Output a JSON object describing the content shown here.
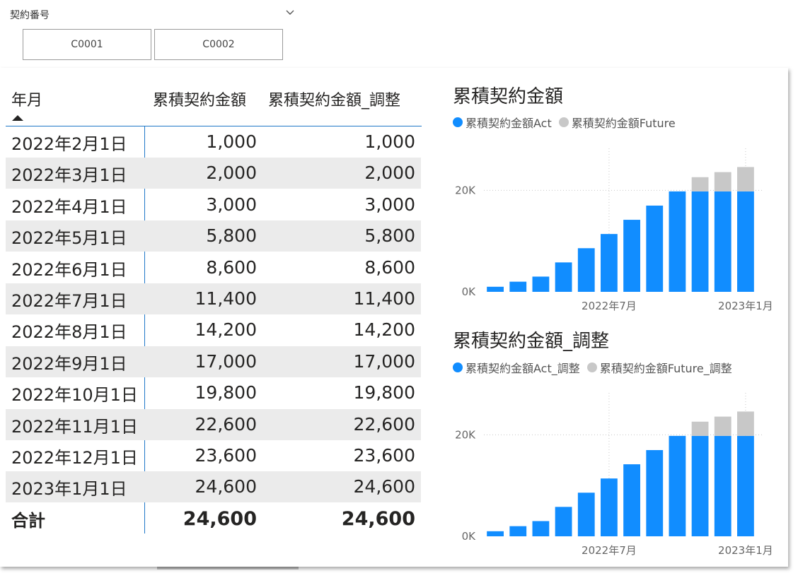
{
  "slicer": {
    "title": "契約番号",
    "options": [
      "C0001",
      "C0002"
    ]
  },
  "table": {
    "headers": [
      "年月",
      "累積契約金額",
      "累積契約金額_調整"
    ],
    "rows": [
      [
        "2022年2月1日",
        "1,000",
        "1,000"
      ],
      [
        "2022年3月1日",
        "2,000",
        "2,000"
      ],
      [
        "2022年4月1日",
        "3,000",
        "3,000"
      ],
      [
        "2022年5月1日",
        "5,800",
        "5,800"
      ],
      [
        "2022年6月1日",
        "8,600",
        "8,600"
      ],
      [
        "2022年7月1日",
        "11,400",
        "11,400"
      ],
      [
        "2022年8月1日",
        "14,200",
        "14,200"
      ],
      [
        "2022年9月1日",
        "17,000",
        "17,000"
      ],
      [
        "2022年10月1日",
        "19,800",
        "19,800"
      ],
      [
        "2022年11月1日",
        "22,600",
        "22,600"
      ],
      [
        "2022年12月1日",
        "23,600",
        "23,600"
      ],
      [
        "2023年1月1日",
        "24,600",
        "24,600"
      ]
    ],
    "total": [
      "合計",
      "24,600",
      "24,600"
    ]
  },
  "colors": {
    "act": "#118DFF",
    "future": "#C8C8C8",
    "table_line": "#1F78C8",
    "row_alt": "#EBEBEB"
  },
  "chart_data": [
    {
      "type": "bar",
      "stacked": true,
      "title": "累積契約金額",
      "categories": [
        "2022-02",
        "2022-03",
        "2022-04",
        "2022-05",
        "2022-06",
        "2022-07",
        "2022-08",
        "2022-09",
        "2022-10",
        "2022-11",
        "2022-12",
        "2023-01"
      ],
      "x_tick_labels": [
        "2022年7月",
        "2023年1月"
      ],
      "y_tick_labels": [
        "0K",
        "20K"
      ],
      "ylim": [
        0,
        28000
      ],
      "grid": true,
      "legend_position": "top-left",
      "series": [
        {
          "name": "累積契約金額Act",
          "color": "#118DFF",
          "values": [
            1000,
            2000,
            3000,
            5800,
            8600,
            11400,
            14200,
            17000,
            19800,
            19800,
            19800,
            19800
          ]
        },
        {
          "name": "累積契約金額Future",
          "color": "#C8C8C8",
          "values": [
            0,
            0,
            0,
            0,
            0,
            0,
            0,
            0,
            0,
            2800,
            3800,
            4800
          ]
        }
      ]
    },
    {
      "type": "bar",
      "stacked": true,
      "title": "累積契約金額_調整",
      "categories": [
        "2022-02",
        "2022-03",
        "2022-04",
        "2022-05",
        "2022-06",
        "2022-07",
        "2022-08",
        "2022-09",
        "2022-10",
        "2022-11",
        "2022-12",
        "2023-01"
      ],
      "x_tick_labels": [
        "2022年7月",
        "2023年1月"
      ],
      "y_tick_labels": [
        "0K",
        "20K"
      ],
      "ylim": [
        0,
        28000
      ],
      "grid": true,
      "legend_position": "top-left",
      "series": [
        {
          "name": "累積契約金額Act_調整",
          "color": "#118DFF",
          "values": [
            1000,
            2000,
            3000,
            5800,
            8600,
            11400,
            14200,
            17000,
            19800,
            19800,
            19800,
            19800
          ]
        },
        {
          "name": "累積契約金額Future_調整",
          "color": "#C8C8C8",
          "values": [
            0,
            0,
            0,
            0,
            0,
            0,
            0,
            0,
            0,
            2800,
            3800,
            4800
          ]
        }
      ]
    }
  ]
}
